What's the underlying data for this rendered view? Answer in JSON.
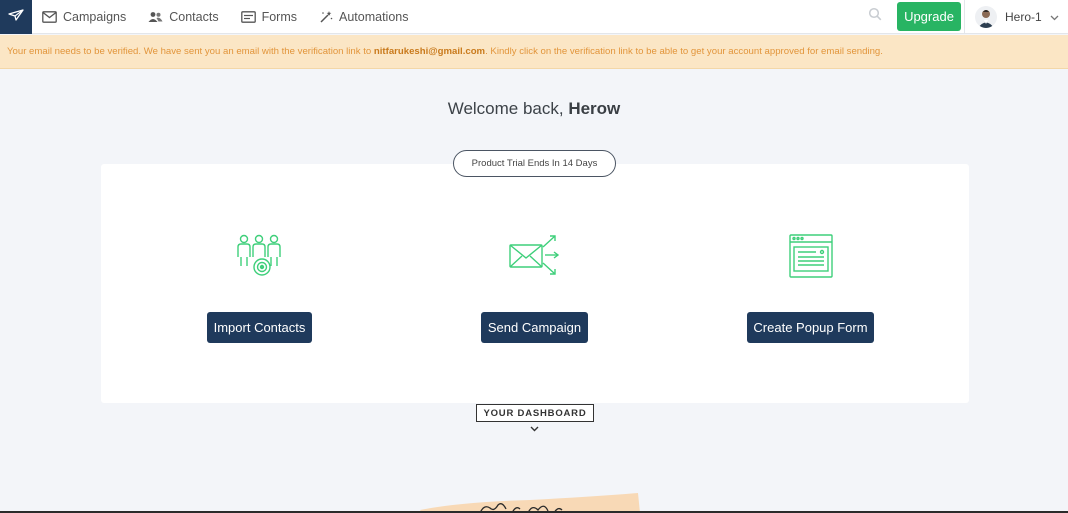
{
  "nav": {
    "logo_icon": "paper-plane-icon",
    "items": [
      {
        "label": "Campaigns",
        "icon": "envelope-icon"
      },
      {
        "label": "Contacts",
        "icon": "users-icon"
      },
      {
        "label": "Forms",
        "icon": "form-icon"
      },
      {
        "label": "Automations",
        "icon": "magic-wand-icon"
      }
    ],
    "search_icon": "search-icon",
    "upgrade_label": "Upgrade",
    "profile_name": "Hero-1",
    "profile_chevron_icon": "chevron-down-icon"
  },
  "banner": {
    "text_before": "Your email needs to be verified. We have sent you an email with the verification link to ",
    "email": "nitfarukeshi@gmail.com",
    "text_after": ". Kindly click on the verification link to be able to get your account approved for email sending."
  },
  "welcome": {
    "greeting": "Welcome back, ",
    "name": "Herow"
  },
  "trial_label": "Product Trial Ends In 14 Days",
  "actions": [
    {
      "label": "Import Contacts",
      "icon": "import-contacts-icon"
    },
    {
      "label": "Send Campaign",
      "icon": "send-campaign-icon"
    },
    {
      "label": "Create Popup Form",
      "icon": "popup-form-icon"
    }
  ],
  "dashboard_label": "YOUR DASHBOARD",
  "colors": {
    "primary": "#1f3a5c",
    "upgrade": "#28b463",
    "banner_bg": "#fbe6c5",
    "banner_text": "#e2953b",
    "icon_green": "#3ecf7a"
  }
}
